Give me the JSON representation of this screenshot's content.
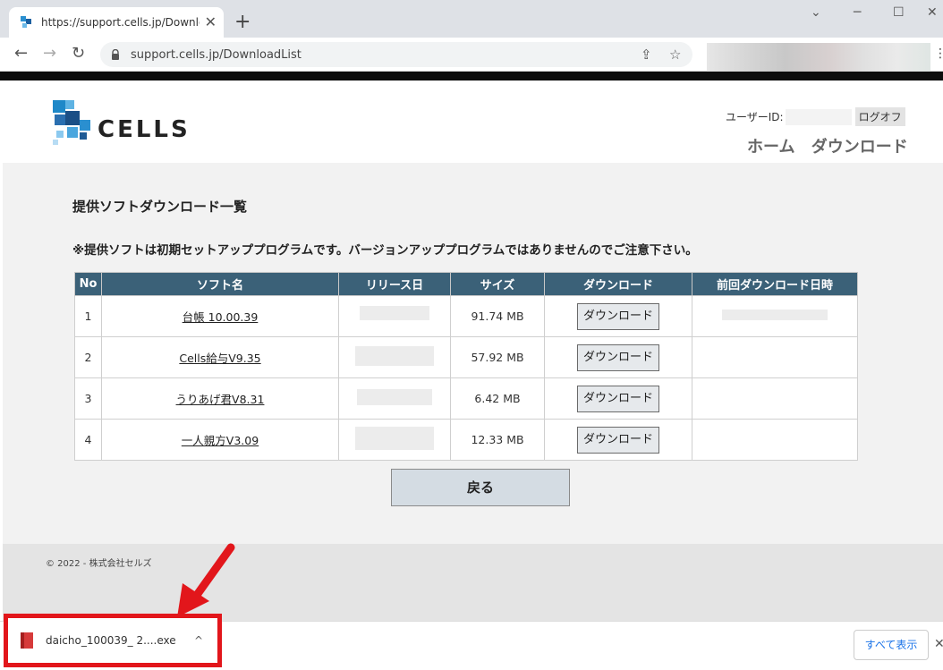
{
  "browser": {
    "tab_title": "https://support.cells.jp/Downloa",
    "tab_close": "✕",
    "new_tab": "+",
    "minimize": "─",
    "maximize": "☐",
    "close": "✕",
    "back": "←",
    "forward": "→",
    "reload": "↻",
    "url": "support.cells.jp/DownloadList",
    "share": "⇪",
    "bookmark": "☆",
    "more": "⋮"
  },
  "header": {
    "logo_text": "CELLS",
    "user_id_label": "ユーザーID:",
    "logoff_label": "ログオフ",
    "nav_home": "ホーム",
    "nav_download": "ダウンロード"
  },
  "main": {
    "title": "提供ソフトダウンロード一覧",
    "notice": "※提供ソフトは初期セットアッププログラムです。バージョンアッププログラムではありませんのでご注意下さい。",
    "columns": [
      "No",
      "ソフト名",
      "リリース日",
      "サイズ",
      "ダウンロード",
      "前回ダウンロード日時"
    ],
    "rows": [
      {
        "no": "1",
        "name": "台帳 10.00.39",
        "size": "91.74 MB",
        "button": "ダウンロード"
      },
      {
        "no": "2",
        "name": "Cells給与V9.35",
        "size": "57.92 MB",
        "button": "ダウンロード"
      },
      {
        "no": "3",
        "name": "うりあげ君V8.31",
        "size": "6.42 MB",
        "button": "ダウンロード"
      },
      {
        "no": "4",
        "name": "一人親方V3.09",
        "size": "12.33 MB",
        "button": "ダウンロード"
      }
    ],
    "back_label": "戻る"
  },
  "footer": {
    "copyright": "© 2022 - 株式会社セルズ"
  },
  "download_shelf": {
    "file_name": "daicho_100039_ 2....exe",
    "chevron": "^",
    "show_all": "すべて表示",
    "close": "✕"
  },
  "colors": {
    "table_header": "#3b6178",
    "highlight_box": "#e2161b",
    "page_bg": "#f2f2f2"
  }
}
